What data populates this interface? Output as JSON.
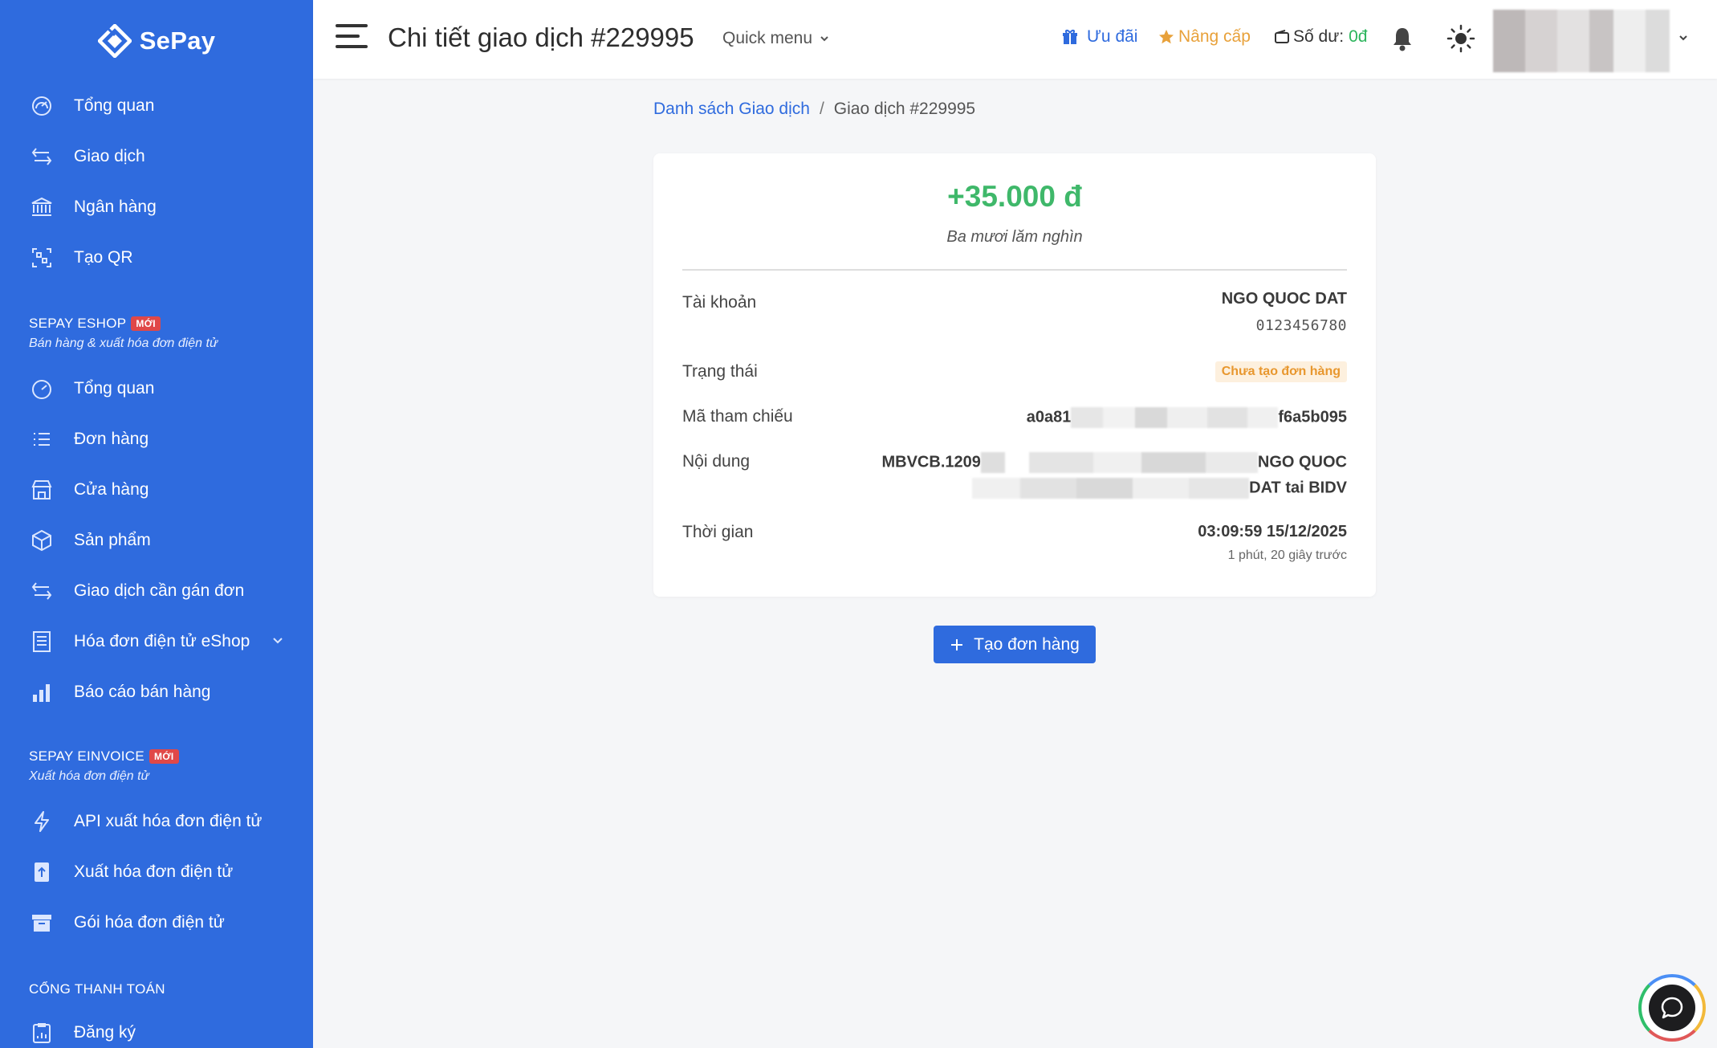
{
  "brand": {
    "name": "SePay"
  },
  "sidebar": {
    "main_items": [
      {
        "label": "Tổng quan",
        "icon": "dashboard-icon"
      },
      {
        "label": "Giao dịch",
        "icon": "transfer-arrows-icon"
      },
      {
        "label": "Ngân hàng",
        "icon": "bank-icon"
      },
      {
        "label": "Tạo QR",
        "icon": "qr-code-icon"
      }
    ],
    "eshop": {
      "title": "SEPAY ESHOP",
      "badge": "MỚI",
      "subtitle": "Bán hàng & xuất hóa đơn điện tử",
      "items": [
        {
          "label": "Tổng quan",
          "icon": "dashboard-icon"
        },
        {
          "label": "Đơn hàng",
          "icon": "list-icon"
        },
        {
          "label": "Cửa hàng",
          "icon": "store-icon"
        },
        {
          "label": "Sản phẩm",
          "icon": "box-icon"
        },
        {
          "label": "Giao dịch cần gán đơn",
          "icon": "transfer-arrows-icon"
        },
        {
          "label": "Hóa đơn điện tử eShop",
          "icon": "receipt-icon"
        },
        {
          "label": "Báo cáo bán hàng",
          "icon": "bar-chart-icon"
        }
      ]
    },
    "einvoice": {
      "title": "SEPAY EINVOICE",
      "badge": "MỚI",
      "subtitle": "Xuất hóa đơn điện tử",
      "items": [
        {
          "label": "API xuất hóa đơn điện tử",
          "icon": "lightning-icon"
        },
        {
          "label": "Xuất hóa đơn điện tử",
          "icon": "upload-file-icon"
        },
        {
          "label": "Gói hóa đơn điện tử",
          "icon": "archive-icon"
        }
      ]
    },
    "payment_gateway": {
      "title": "CỔNG THANH TOÁN",
      "items": [
        {
          "label": "Đăng ký",
          "icon": "clipboard-icon"
        }
      ]
    }
  },
  "topbar": {
    "title": "Chi tiết giao dịch #229995",
    "quick_menu": "Quick menu",
    "offer": "Ưu đãi",
    "upgrade": "Nâng cấp",
    "balance_label": "Số dư:",
    "balance_value": "0đ"
  },
  "breadcrumb": {
    "parent": "Danh sách Giao dịch",
    "separator": "/",
    "current": "Giao dịch #229995"
  },
  "transaction": {
    "amount": "+35.000 đ",
    "amount_words": "Ba mươi lăm nghìn",
    "account_label": "Tài khoản",
    "account_name": "NGO QUOC DAT",
    "account_number": "0123456780",
    "status_label": "Trạng thái",
    "status_value": "Chưa tạo đơn hàng",
    "reference_label": "Mã tham chiếu",
    "reference_prefix": "a0a81",
    "reference_suffix": "f6a5b095",
    "content_label": "Nội dung",
    "content_prefix": "MBVCB.1209",
    "content_line1_end": "NGO QUOC",
    "content_line2_end": "DAT tai BIDV",
    "time_label": "Thời gian",
    "time_value": "03:09:59 15/12/2025",
    "time_relative": "1 phút, 20 giây trước"
  },
  "actions": {
    "create_order": "Tạo đơn hàng"
  },
  "colors": {
    "sidebar_bg": "#2f6bde",
    "accent": "#2f6bde",
    "amount_green": "#3fb86a",
    "upgrade_orange": "#e8a13a",
    "status_badge_bg": "#fdf0de",
    "badge_red": "#e04848"
  }
}
